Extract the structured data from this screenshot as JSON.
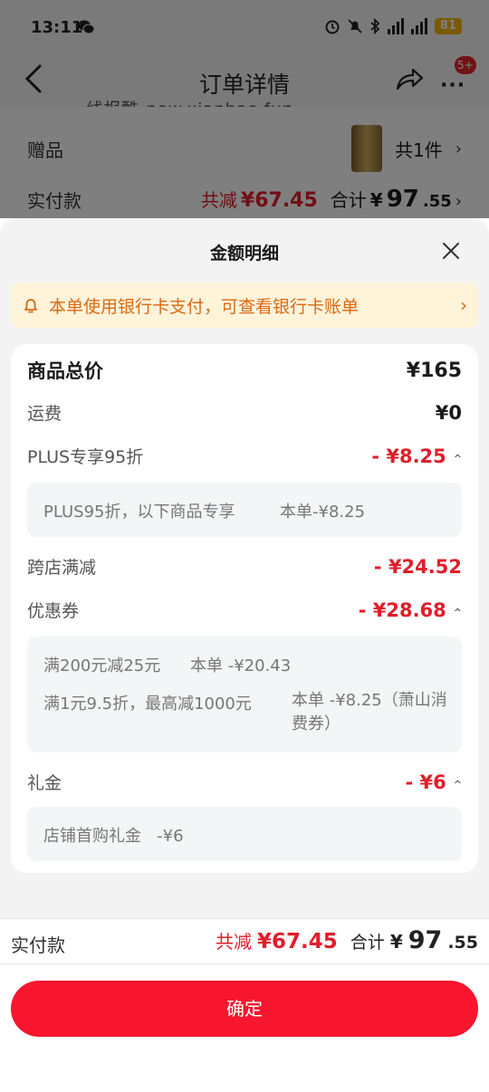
{
  "status_bar": {
    "time": "13:11",
    "battery": "81",
    "network": "5G"
  },
  "header": {
    "title": "订单详情",
    "badge": "5+",
    "watermark": "线报酷-new.xianbao.fun"
  },
  "order_rows": {
    "gift_label": "赠品",
    "gift_count": "共1件",
    "paid_label": "实付款",
    "reduce_label": "共减",
    "reduce_value": "¥67.45",
    "total_label": "合计",
    "total_symbol": "¥",
    "total_int": "97",
    "total_dec": ".55"
  },
  "sheet": {
    "title": "金额明细",
    "notice": "本单使用银行卡支付，可查看银行卡账单",
    "rows": {
      "goods_total_label": "商品总价",
      "goods_total_value": "¥165",
      "shipping_label": "运费",
      "shipping_value": "¥0",
      "plus_label": "PLUS专享95折",
      "plus_value": "- ¥8.25",
      "plus_detail_name": "PLUS95折，以下商品专享",
      "plus_detail_value": "本单-¥8.25",
      "cross_label": "跨店满减",
      "cross_value": "- ¥24.52",
      "coupon_label": "优惠券",
      "coupon_value": "- ¥28.68",
      "coupon_1_name": "满200元减25元",
      "coupon_1_value": "本单 -¥20.43",
      "coupon_2_name": "满1元9.5折，最高减1000元",
      "coupon_2_value": "本单 -¥8.25（萧山消费券）",
      "gift_money_label": "礼金",
      "gift_money_value": "- ¥6",
      "gift_money_detail": "店铺首购礼金   -¥6"
    }
  },
  "bottom": {
    "paid_label": "实付款",
    "reduce_label": "共减",
    "reduce_value": "¥67.45",
    "total_label": "合计",
    "total_symbol": "¥",
    "total_int": "97",
    "total_dec": ".55",
    "confirm_label": "确定"
  },
  "colors": {
    "accent": "#f8152e",
    "price_red": "#e01e2a",
    "notice_bg": "#fff3da",
    "notice_text": "#d96a12"
  }
}
